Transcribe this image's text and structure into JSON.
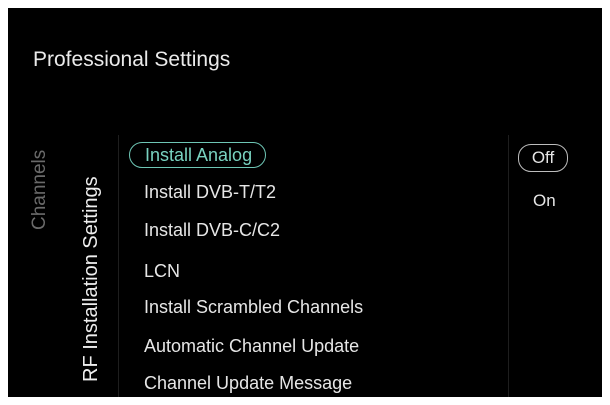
{
  "page_title": "Professional Settings",
  "breadcrumb": {
    "parent": "Channels",
    "current": "RF Installation Settings"
  },
  "menu": {
    "items": [
      {
        "label": "Install Analog",
        "selected": true
      },
      {
        "label": "Install DVB-T/T2",
        "selected": false
      },
      {
        "label": "Install DVB-C/C2",
        "selected": false
      },
      {
        "label": "LCN",
        "selected": false
      },
      {
        "label": "Install Scrambled Channels",
        "selected": false
      },
      {
        "label": "Automatic Channel Update",
        "selected": false
      },
      {
        "label": "Channel Update Message",
        "selected": false
      }
    ]
  },
  "options": {
    "items": [
      {
        "label": "Off",
        "selected": true
      },
      {
        "label": "On",
        "selected": false
      }
    ]
  },
  "colors": {
    "background": "#000000",
    "accent": "#79d2c0",
    "text": "#e6e6e6",
    "muted": "#6a6a6a"
  }
}
